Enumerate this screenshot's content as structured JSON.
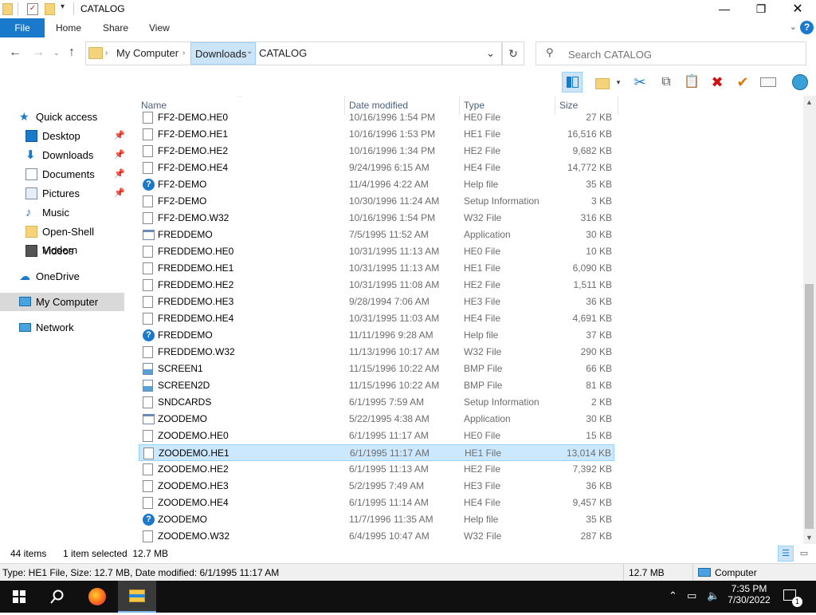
{
  "window": {
    "title": "CATALOG"
  },
  "ribbon": {
    "tabs": [
      "File",
      "Home",
      "Share",
      "View"
    ],
    "help": "?"
  },
  "address": {
    "crumbs": [
      "My Computer",
      "Downloads",
      "CATALOG"
    ]
  },
  "search": {
    "placeholder": "Search CATALOG"
  },
  "columns": {
    "name": "Name",
    "date": "Date modified",
    "type": "Type",
    "size": "Size"
  },
  "nav": {
    "items": [
      {
        "label": "Quick access"
      },
      {
        "label": "Desktop"
      },
      {
        "label": "Downloads"
      },
      {
        "label": "Documents"
      },
      {
        "label": "Pictures"
      },
      {
        "label": "Music"
      },
      {
        "label": "Open-Shell Modern"
      },
      {
        "label": "Videos"
      },
      {
        "label": "OneDrive"
      },
      {
        "label": "My Computer"
      },
      {
        "label": "Network"
      }
    ]
  },
  "files": [
    {
      "name": "FF2-DEMO.HE0",
      "date": "10/16/1996 1:54 PM",
      "type": "HE0 File",
      "size": "27 KB",
      "icon": "file-icon"
    },
    {
      "name": "FF2-DEMO.HE1",
      "date": "10/16/1996 1:53 PM",
      "type": "HE1 File",
      "size": "16,516 KB",
      "icon": "file-icon"
    },
    {
      "name": "FF2-DEMO.HE2",
      "date": "10/16/1996 1:34 PM",
      "type": "HE2 File",
      "size": "9,682 KB",
      "icon": "file-icon"
    },
    {
      "name": "FF2-DEMO.HE4",
      "date": "9/24/1996 6:15 AM",
      "type": "HE4 File",
      "size": "14,772 KB",
      "icon": "file-icon"
    },
    {
      "name": "FF2-DEMO",
      "date": "11/4/1996 4:22 AM",
      "type": "Help file",
      "size": "35 KB",
      "icon": "help-icon"
    },
    {
      "name": "FF2-DEMO",
      "date": "10/30/1996 11:24 AM",
      "type": "Setup Information",
      "size": "3 KB",
      "icon": "setup-icon"
    },
    {
      "name": "FF2-DEMO.W32",
      "date": "10/16/1996 1:54 PM",
      "type": "W32 File",
      "size": "316 KB",
      "icon": "file-icon"
    },
    {
      "name": "FREDDEMO",
      "date": "7/5/1995 11:52 AM",
      "type": "Application",
      "size": "30 KB",
      "icon": "app-icon"
    },
    {
      "name": "FREDDEMO.HE0",
      "date": "10/31/1995 11:13 AM",
      "type": "HE0 File",
      "size": "10 KB",
      "icon": "file-icon"
    },
    {
      "name": "FREDDEMO.HE1",
      "date": "10/31/1995 11:13 AM",
      "type": "HE1 File",
      "size": "6,090 KB",
      "icon": "file-icon"
    },
    {
      "name": "FREDDEMO.HE2",
      "date": "10/31/1995 11:08 AM",
      "type": "HE2 File",
      "size": "1,511 KB",
      "icon": "file-icon"
    },
    {
      "name": "FREDDEMO.HE3",
      "date": "9/28/1994 7:06 AM",
      "type": "HE3 File",
      "size": "36 KB",
      "icon": "file-icon"
    },
    {
      "name": "FREDDEMO.HE4",
      "date": "10/31/1995 11:03 AM",
      "type": "HE4 File",
      "size": "4,691 KB",
      "icon": "file-icon"
    },
    {
      "name": "FREDDEMO",
      "date": "11/11/1996 9:28 AM",
      "type": "Help file",
      "size": "37 KB",
      "icon": "help-icon"
    },
    {
      "name": "FREDDEMO.W32",
      "date": "11/13/1996 10:17 AM",
      "type": "W32 File",
      "size": "290 KB",
      "icon": "file-icon"
    },
    {
      "name": "SCREEN1",
      "date": "11/15/1996 10:22 AM",
      "type": "BMP File",
      "size": "66 KB",
      "icon": "image-icon"
    },
    {
      "name": "SCREEN2D",
      "date": "11/15/1996 10:22 AM",
      "type": "BMP File",
      "size": "81 KB",
      "icon": "image-icon"
    },
    {
      "name": "SNDCARDS",
      "date": "6/1/1995 7:59 AM",
      "type": "Setup Information",
      "size": "2 KB",
      "icon": "setup-icon"
    },
    {
      "name": "ZOODEMO",
      "date": "5/22/1995 4:38 AM",
      "type": "Application",
      "size": "30 KB",
      "icon": "app-icon"
    },
    {
      "name": "ZOODEMO.HE0",
      "date": "6/1/1995 11:17 AM",
      "type": "HE0 File",
      "size": "15 KB",
      "icon": "file-icon"
    },
    {
      "name": "ZOODEMO.HE1",
      "date": "6/1/1995 11:17 AM",
      "type": "HE1 File",
      "size": "13,014 KB",
      "icon": "file-icon",
      "selected": true
    },
    {
      "name": "ZOODEMO.HE2",
      "date": "6/1/1995 11:13 AM",
      "type": "HE2 File",
      "size": "7,392 KB",
      "icon": "file-icon"
    },
    {
      "name": "ZOODEMO.HE3",
      "date": "5/2/1995 7:49 AM",
      "type": "HE3 File",
      "size": "36 KB",
      "icon": "file-icon"
    },
    {
      "name": "ZOODEMO.HE4",
      "date": "6/1/1995 11:14 AM",
      "type": "HE4 File",
      "size": "9,457 KB",
      "icon": "file-icon"
    },
    {
      "name": "ZOODEMO",
      "date": "11/7/1996 11:35 AM",
      "type": "Help file",
      "size": "35 KB",
      "icon": "help-icon"
    },
    {
      "name": "ZOODEMO.W32",
      "date": "6/4/1995 10:47 AM",
      "type": "W32 File",
      "size": "287 KB",
      "icon": "file-icon"
    }
  ],
  "status": {
    "items": "44 items",
    "selected": "1 item selected  12.7 MB"
  },
  "details": {
    "text": "Type: HE1 File, Size: 12.7 MB, Date modified: 6/1/1995 11:17 AM",
    "size": "12.7 MB",
    "location": "Computer"
  },
  "taskbar": {
    "time": "7:35 PM",
    "date": "7/30/2022",
    "notifications": "1"
  },
  "colors": {
    "accent": "#1979ca",
    "selection": "#cce8ff",
    "taskbar": "#101010"
  }
}
